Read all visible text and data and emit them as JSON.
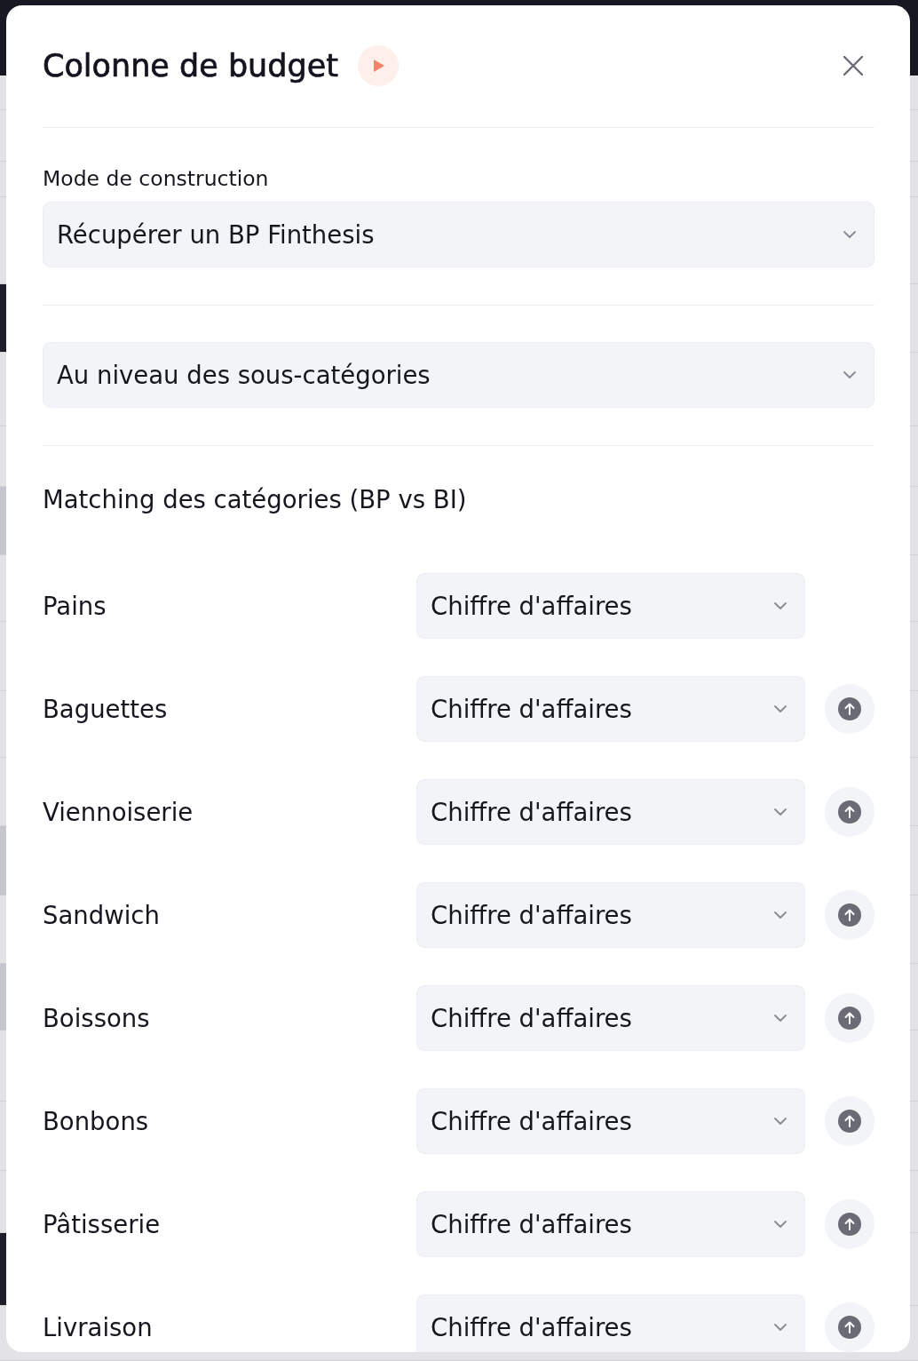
{
  "dialog": {
    "title": "Colonne de budget"
  },
  "construction_mode": {
    "label": "Mode de construction",
    "value": "Récupérer un BP Finthesis"
  },
  "level_select": {
    "value": "Au niveau des sous-catégories"
  },
  "matching": {
    "title": "Matching des catégories (BP vs BI)",
    "rows": [
      {
        "label": "Pains",
        "value": "Chiffre d'affaires",
        "can_move_up": false
      },
      {
        "label": "Baguettes",
        "value": "Chiffre d'affaires",
        "can_move_up": true
      },
      {
        "label": "Viennoiserie",
        "value": "Chiffre d'affaires",
        "can_move_up": true
      },
      {
        "label": "Sandwich",
        "value": "Chiffre d'affaires",
        "can_move_up": true
      },
      {
        "label": "Boissons",
        "value": "Chiffre d'affaires",
        "can_move_up": true
      },
      {
        "label": "Bonbons",
        "value": "Chiffre d'affaires",
        "can_move_up": true
      },
      {
        "label": "Pâtisserie",
        "value": "Chiffre d'affaires",
        "can_move_up": true
      },
      {
        "label": "Livraison",
        "value": "Chiffre d'affaires",
        "can_move_up": true
      }
    ]
  }
}
